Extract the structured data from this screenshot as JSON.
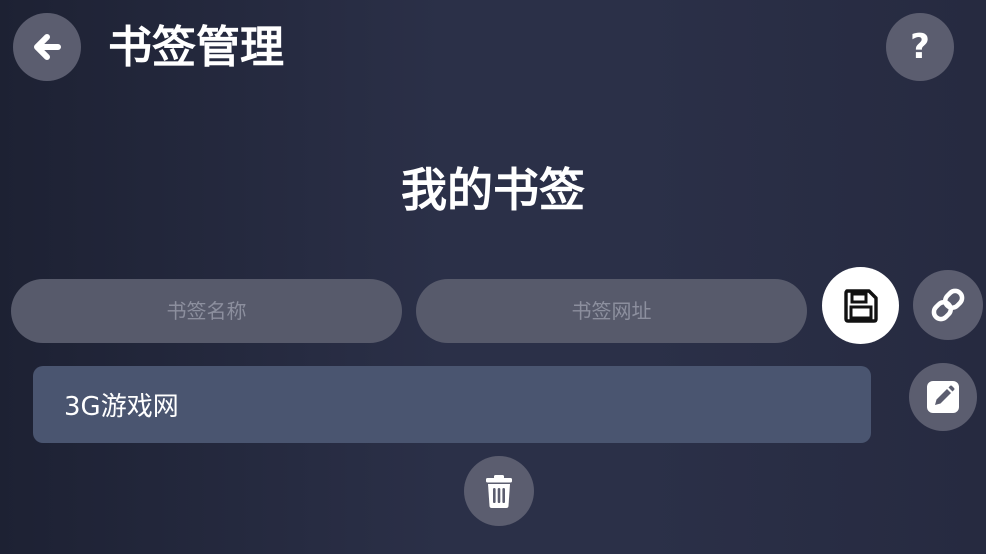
{
  "header": {
    "title": "书签管理",
    "back_icon": "arrow-left-icon",
    "help_label": "?"
  },
  "section": {
    "title": "我的书签"
  },
  "form": {
    "name_placeholder": "书签名称",
    "url_placeholder": "书签网址",
    "save_icon": "floppy-disk-icon",
    "link_icon": "link-icon"
  },
  "bookmarks": [
    {
      "name": "3G游戏网"
    }
  ],
  "item_actions": {
    "edit_icon": "pencil-square-icon",
    "delete_icon": "trash-icon"
  },
  "colors": {
    "background": "#2b3048",
    "button": "#5b5d6f",
    "input": "#575a6b",
    "bookmark_item": "#4a5570",
    "save_button": "#ffffff"
  }
}
